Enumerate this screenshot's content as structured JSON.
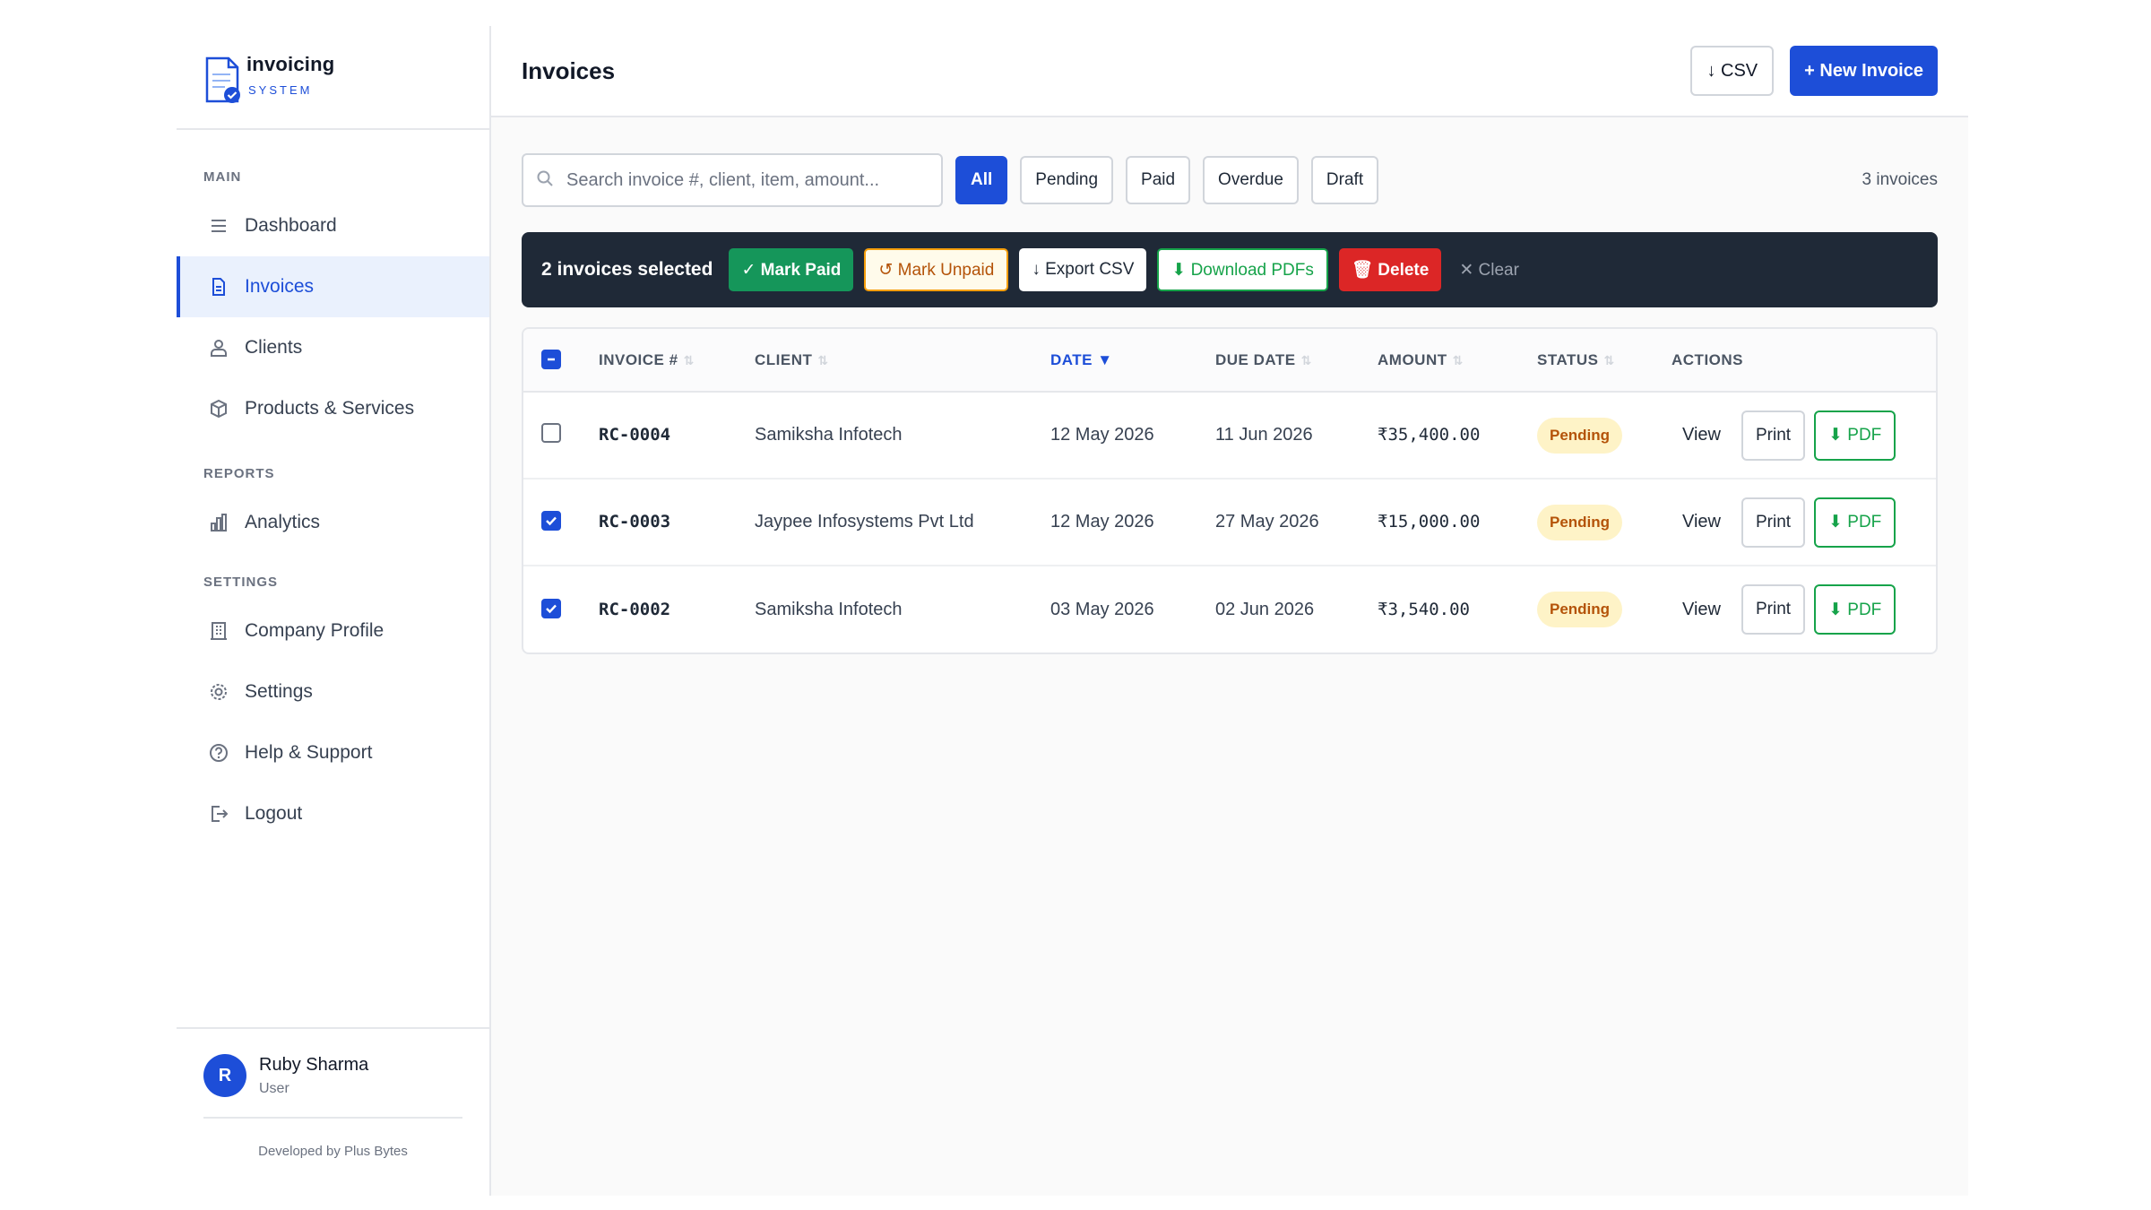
{
  "brand": {
    "title": "invoicing",
    "subtitle": "SYSTEM"
  },
  "sidebar": {
    "sections": [
      {
        "label": "MAIN"
      },
      {
        "label": "REPORTS"
      },
      {
        "label": "SETTINGS"
      }
    ],
    "items": [
      {
        "label": "Dashboard",
        "icon": "menu-icon"
      },
      {
        "label": "Invoices",
        "icon": "document-icon",
        "active": true
      },
      {
        "label": "Clients",
        "icon": "users-icon"
      },
      {
        "label": "Products & Services",
        "icon": "box-icon"
      },
      {
        "label": "Analytics",
        "icon": "bar-chart-icon"
      },
      {
        "label": "Company Profile",
        "icon": "building-icon"
      },
      {
        "label": "Settings",
        "icon": "gear-icon"
      },
      {
        "label": "Help & Support",
        "icon": "help-icon"
      },
      {
        "label": "Logout",
        "icon": "logout-icon"
      }
    ],
    "user": {
      "initial": "R",
      "name": "Ruby Sharma",
      "role": "User"
    },
    "footer": "Developed by Plus Bytes"
  },
  "header": {
    "title": "Invoices",
    "csv_label": "↓ CSV",
    "new_label": "+ New Invoice"
  },
  "filters": {
    "search_placeholder": "Search invoice #, client, item, amount...",
    "chips": [
      "All",
      "Pending",
      "Paid",
      "Overdue",
      "Draft"
    ],
    "active_chip": "All",
    "count_text": "3 invoices"
  },
  "bulk": {
    "selected_text": "2 invoices selected",
    "mark_paid": "✓ Mark Paid",
    "mark_unpaid": "↺ Mark Unpaid",
    "export_csv": "↓ Export CSV",
    "download_pdfs": "⬇ Download PDFs",
    "delete": "🗑 Delete",
    "clear": "✕ Clear"
  },
  "table": {
    "columns": [
      "INVOICE #",
      "CLIENT",
      "DATE",
      "DUE DATE",
      "AMOUNT",
      "STATUS",
      "ACTIONS"
    ],
    "sort_indicator": "▼",
    "rows": [
      {
        "checked": false,
        "invoice": "RC-0004",
        "client": "Samiksha Infotech",
        "date": "12 May 2026",
        "due": "11 Jun 2026",
        "amount": "₹35,400.00",
        "status": "Pending"
      },
      {
        "checked": true,
        "invoice": "RC-0003",
        "client": "Jaypee Infosystems Pvt Ltd",
        "date": "12 May 2026",
        "due": "27 May 2026",
        "amount": "₹15,000.00",
        "status": "Pending"
      },
      {
        "checked": true,
        "invoice": "RC-0002",
        "client": "Samiksha Infotech",
        "date": "03 May 2026",
        "due": "02 Jun 2026",
        "amount": "₹3,540.00",
        "status": "Pending"
      }
    ],
    "action_labels": {
      "view": "View",
      "print": "Print",
      "pdf": "⬇ PDF"
    }
  },
  "colors": {
    "accent": "#1d4ed8",
    "success": "#16a34a",
    "danger": "#dc2626",
    "warning_bg": "#fef3c7",
    "warning_text": "#b45309",
    "dark_bar": "#1f2937"
  }
}
